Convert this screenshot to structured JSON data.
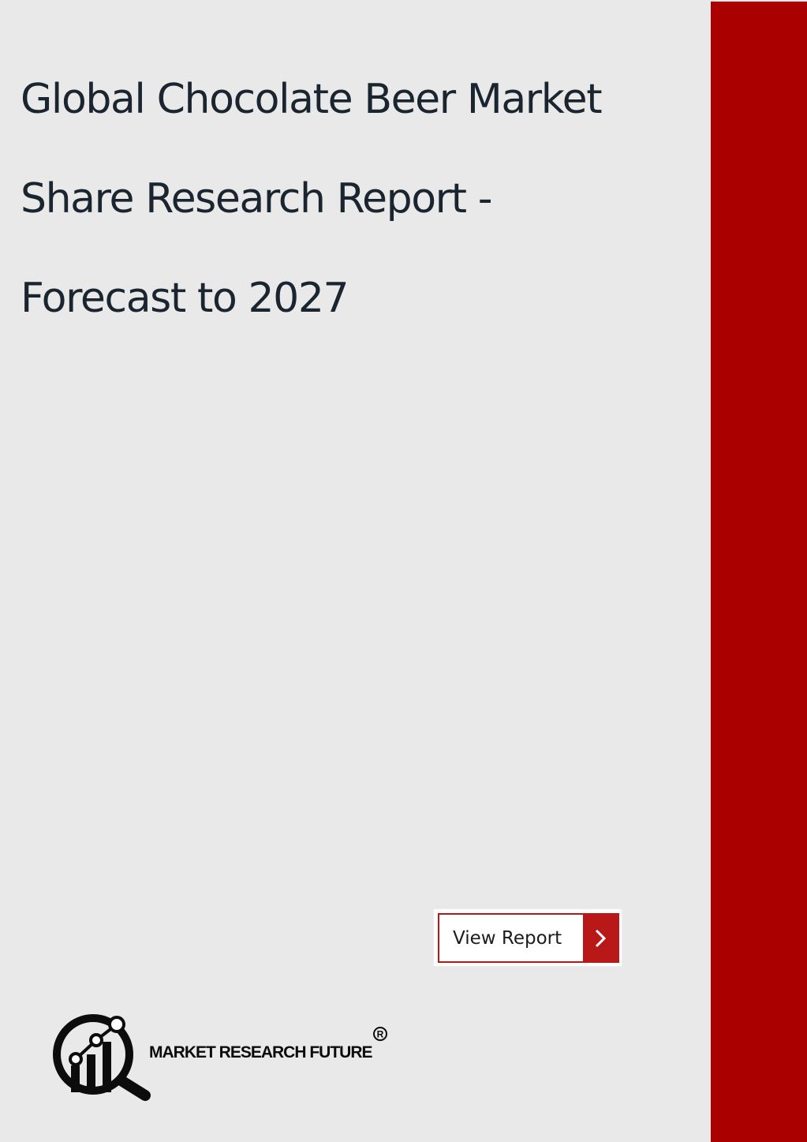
{
  "document": {
    "title_lines": [
      "Global Chocolate Beer Market",
      "Share Research Report -",
      "Forecast to 2027"
    ]
  },
  "cta": {
    "label": "View Report",
    "icon": "chevron-right-icon"
  },
  "brand": {
    "name": "MARKET RESEARCH FUTURE",
    "reg_mark": "®",
    "logo_icon": "magnifier-chart-icon"
  },
  "colors": {
    "background": "#e9e9e9",
    "accent_band": "#aa0000",
    "button_red": "#b81818",
    "title_text": "#1a2530"
  }
}
